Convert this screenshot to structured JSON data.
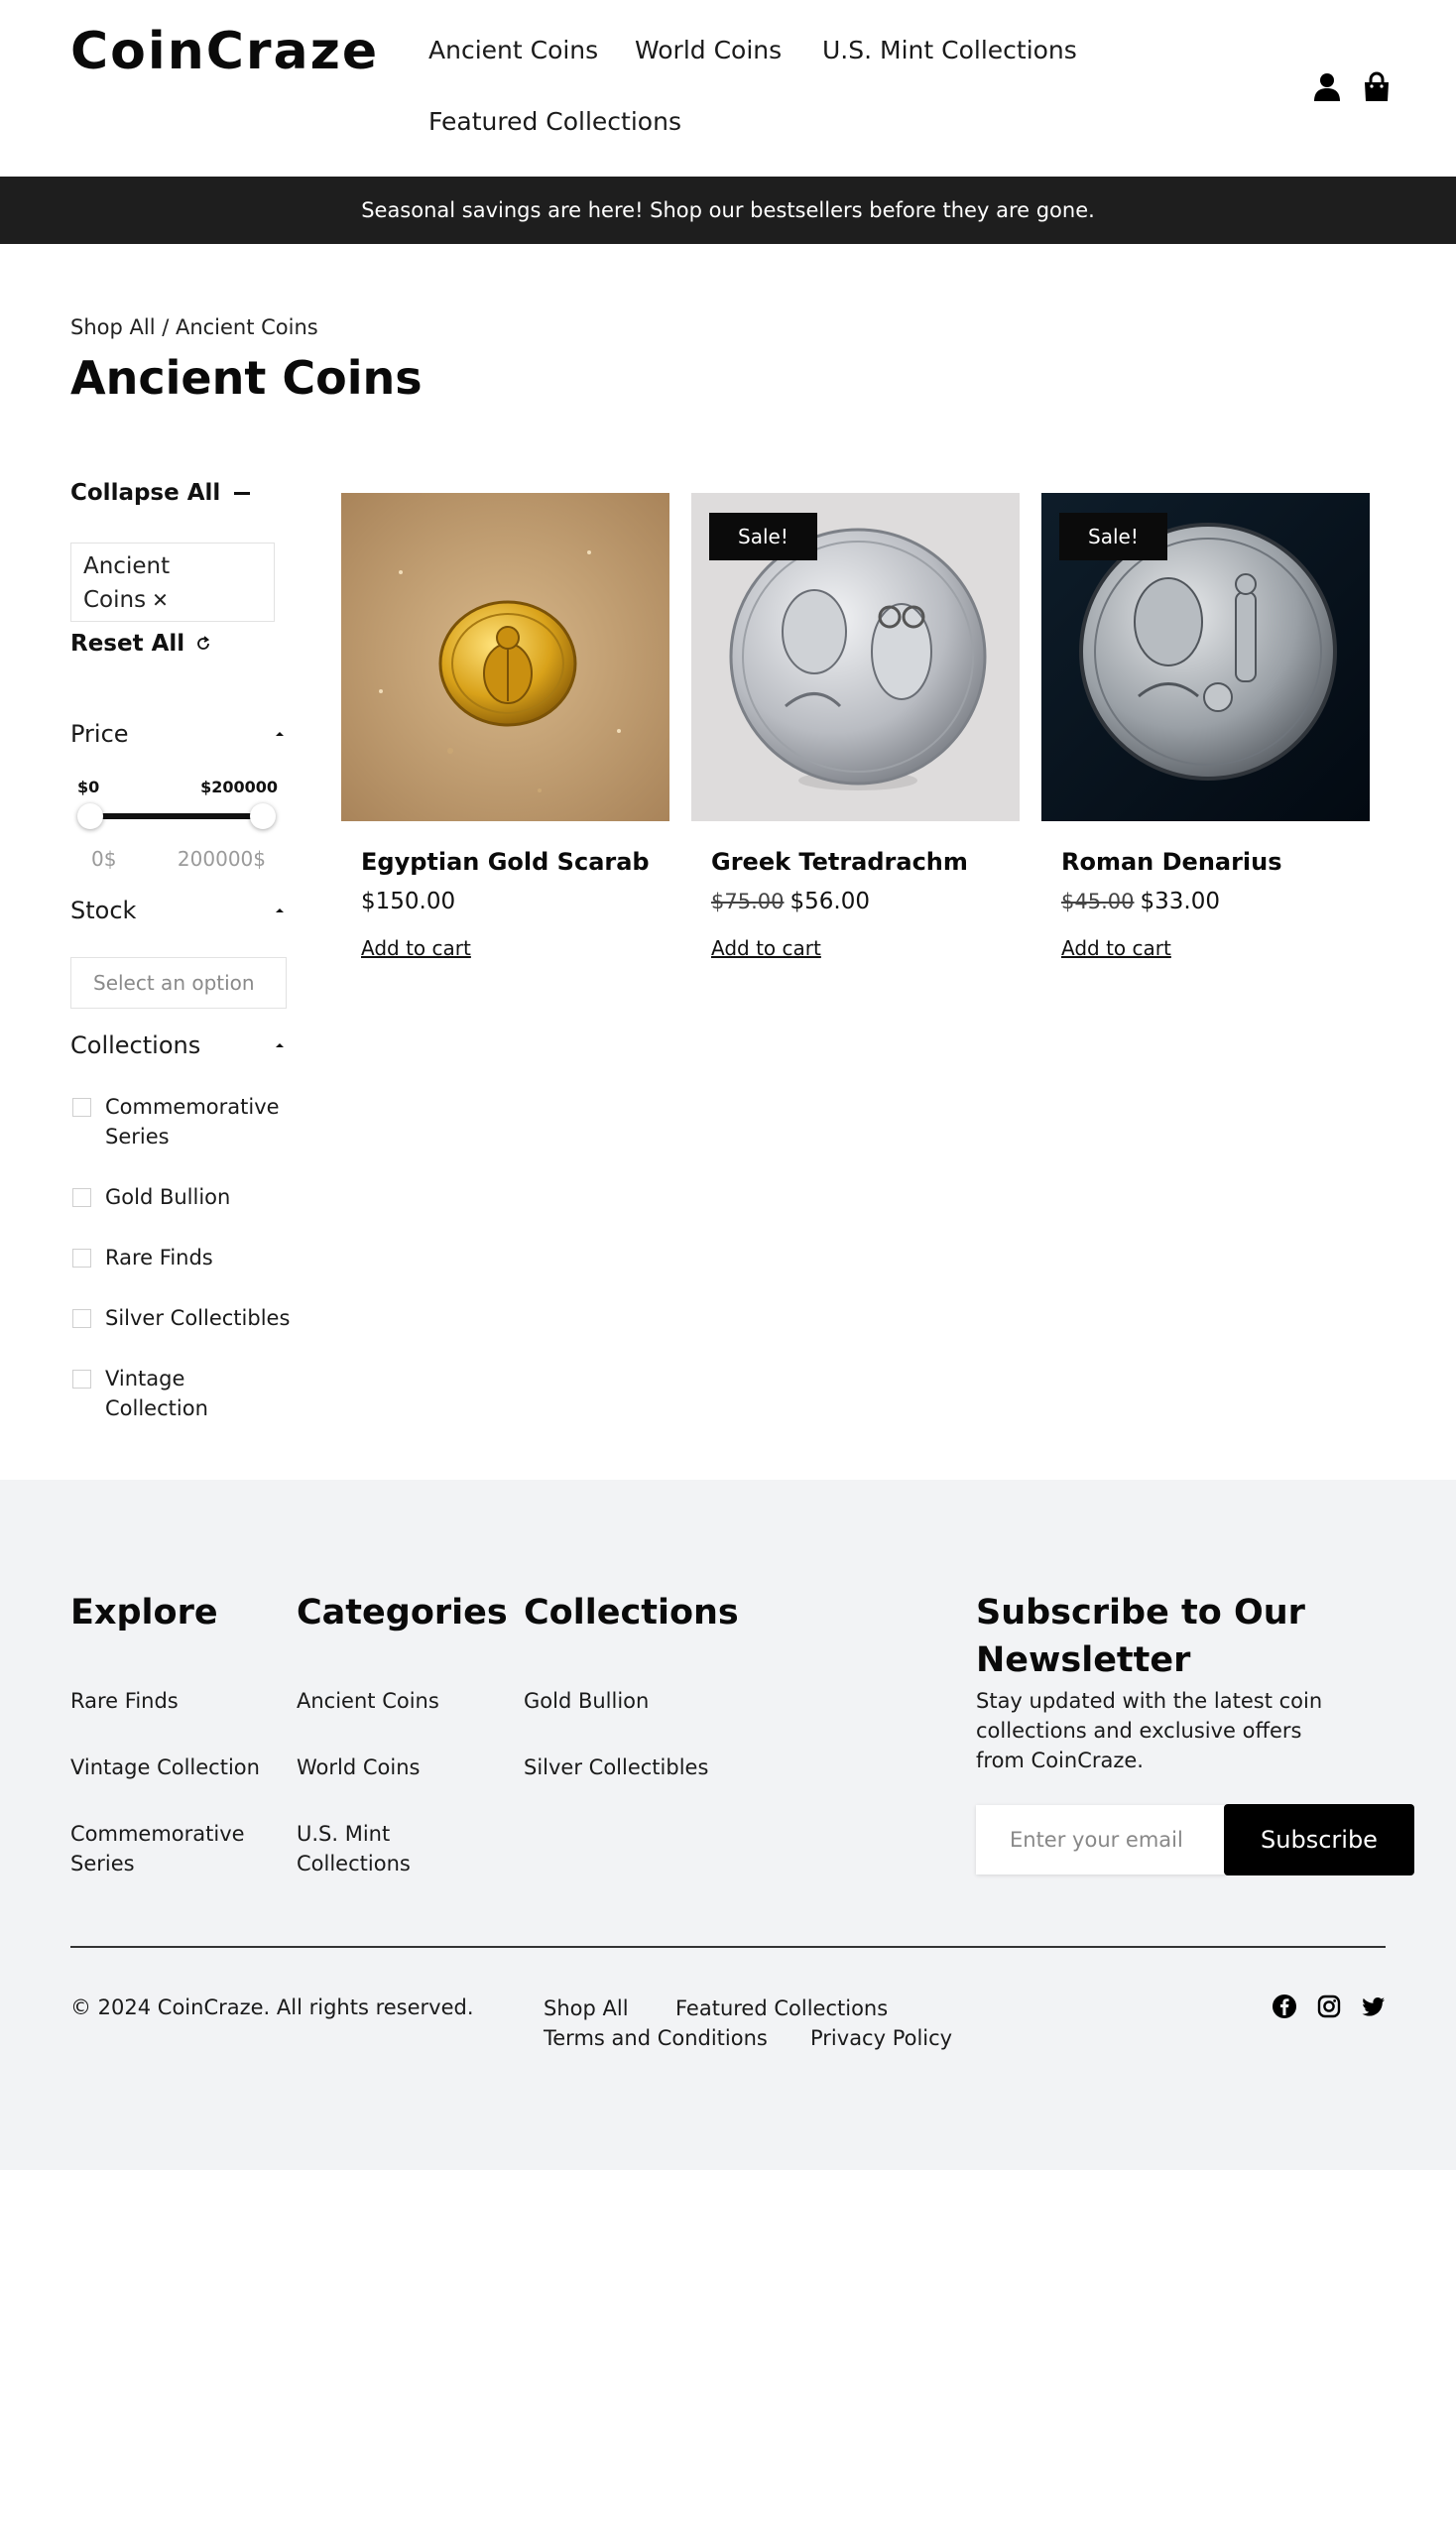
{
  "header": {
    "logo": "CoinCraze",
    "nav": [
      "Ancient Coins",
      "World Coins",
      "U.S. Mint Collections",
      "Featured Collections"
    ],
    "icons": [
      "user-icon",
      "shopping-bag-icon"
    ]
  },
  "promo": {
    "text": "Seasonal savings are here! Shop our bestsellers before they are gone."
  },
  "breadcrumb": "Shop All / Ancient Coins",
  "page_title": "Ancient Coins",
  "sidebar": {
    "collapse_all": "Collapse All",
    "active_filter": "Ancient Coins",
    "reset_all": "Reset All",
    "price": {
      "label": "Price",
      "min_label": "$0",
      "max_label": "$200000",
      "min_value": "0$",
      "max_value": "200000$",
      "range_low_fraction": 0,
      "range_high_fraction": 1
    },
    "stock": {
      "label": "Stock",
      "placeholder": "Select an option"
    },
    "collections": {
      "label": "Collections",
      "items": [
        "Commemorative Series",
        "Gold Bullion",
        "Rare Finds",
        "Silver Collectibles",
        "Vintage Collection"
      ]
    }
  },
  "products": [
    {
      "name": "Egyptian Gold Scarab",
      "old_price": "",
      "price": "$150.00",
      "sale": "",
      "cta": "Add to cart"
    },
    {
      "name": "Greek Tetradrachm",
      "old_price": "$75.00",
      "price": "$56.00",
      "sale": "Sale!",
      "cta": "Add to cart"
    },
    {
      "name": "Roman Denarius",
      "old_price": "$45.00",
      "price": "$33.00",
      "sale": "Sale!",
      "cta": "Add to cart"
    }
  ],
  "footer": {
    "explore": {
      "title": "Explore",
      "links": [
        "Rare Finds",
        "Vintage Collection",
        "Commemorative Series"
      ]
    },
    "categories": {
      "title": "Categories",
      "links": [
        "Ancient Coins",
        "World Coins",
        "U.S. Mint Collections"
      ]
    },
    "collections": {
      "title": "Collections",
      "links": [
        "Gold Bullion",
        "Silver Collectibles"
      ]
    },
    "newsletter": {
      "title": "Subscribe to Our Newsletter",
      "description": "Stay updated with the latest coin collections and exclusive offers from CoinCraze.",
      "placeholder": "Enter your email",
      "button": "Subscribe"
    },
    "copyright": "© 2024 CoinCraze. All rights reserved.",
    "bottom_links": [
      "Shop All",
      "Featured Collections",
      "Terms and Conditions",
      "Privacy Policy"
    ],
    "social": [
      "facebook-icon",
      "instagram-icon",
      "twitter-icon"
    ]
  }
}
